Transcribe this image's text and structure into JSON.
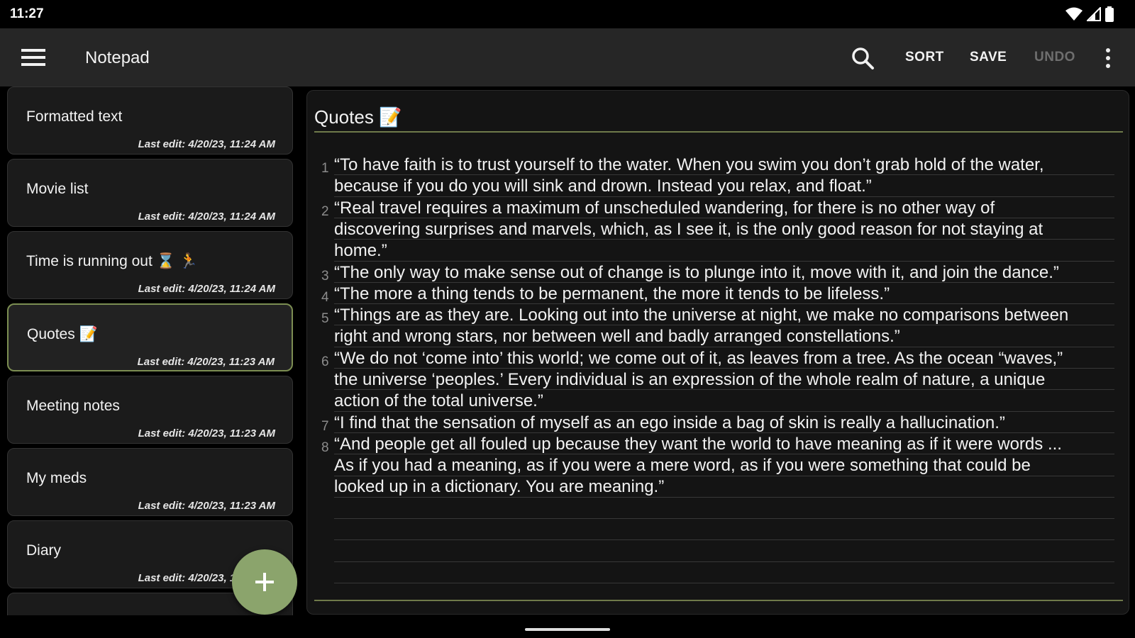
{
  "status_bar": {
    "time": "11:27"
  },
  "app_bar": {
    "title": "Notepad",
    "actions": {
      "sort": "SORT",
      "save": "SAVE",
      "undo": "UNDO"
    }
  },
  "notes": [
    {
      "title": "Formatted text",
      "date": "Last edit: 4/20/23, 11:24 AM",
      "selected": false
    },
    {
      "title": "Movie list",
      "date": "Last edit: 4/20/23, 11:24 AM",
      "selected": false
    },
    {
      "title": "Time is running out ⌛ 🏃",
      "date": "Last edit: 4/20/23, 11:24 AM",
      "selected": false
    },
    {
      "title": "Quotes 📝",
      "date": "Last edit: 4/20/23, 11:23 AM",
      "selected": true
    },
    {
      "title": "Meeting notes",
      "date": "Last edit: 4/20/23, 11:23 AM",
      "selected": false
    },
    {
      "title": "My meds",
      "date": "Last edit: 4/20/23, 11:23 AM",
      "selected": false
    },
    {
      "title": "Diary",
      "date": "Last edit: 4/20/23, 11:23 AM",
      "selected": false
    }
  ],
  "editor": {
    "title": "Quotes 📝",
    "quotes": [
      {
        "num": "1",
        "lines": [
          "“To have faith is to trust yourself to the water. When you swim you don’t grab hold of the water,",
          "because if you do you will sink and drown. Instead you relax, and float.”"
        ]
      },
      {
        "num": "2",
        "lines": [
          "“Real travel requires a maximum of unscheduled wandering, for there is no other way of",
          "discovering surprises and marvels, which, as I see it, is the only good reason for not staying at",
          "home.”"
        ]
      },
      {
        "num": "3",
        "lines": [
          "“The only way to make sense out of change is to plunge into it, move with it, and join the dance.”"
        ]
      },
      {
        "num": "4",
        "lines": [
          "“The more a thing tends to be permanent, the more it tends to be lifeless.”"
        ]
      },
      {
        "num": "5",
        "lines": [
          "“Things are as they are. Looking out into the universe at night, we make no comparisons between",
          "right and wrong stars, nor between well and badly arranged constellations.”"
        ]
      },
      {
        "num": "6",
        "lines": [
          "“We do not ‘come into’ this world; we come out of it, as leaves from a tree. As the ocean “waves,”",
          "the universe ‘peoples.’ Every individual is an expression of the whole realm of nature, a unique",
          "action of the total universe.”"
        ]
      },
      {
        "num": "7",
        "lines": [
          "“I find that the sensation of myself as an ego inside a bag of skin is really a hallucination.”"
        ]
      },
      {
        "num": "8",
        "lines": [
          "“And people get all fouled up because they want the world to have meaning as if it were words ...",
          "As if you had a meaning, as if you were a mere word, as if you were something that could be",
          "looked up in a dictionary. You are meaning.”"
        ]
      }
    ]
  },
  "colors": {
    "accent": "#8ba46c",
    "selected_border": "#7c8e52",
    "background": "#000000",
    "appbar": "#262626"
  },
  "icons": {
    "menu": "menu-icon",
    "search": "search-icon",
    "more": "more-vert-icon",
    "fab": "add-icon"
  }
}
